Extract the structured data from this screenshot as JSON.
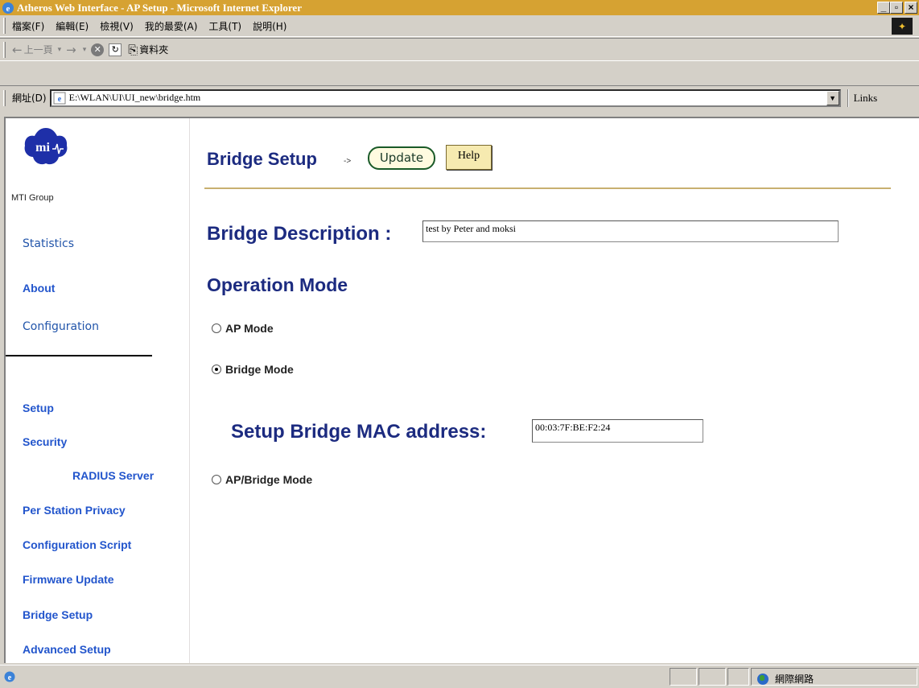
{
  "window": {
    "title": "Atheros Web Interface - AP Setup - Microsoft Internet Explorer",
    "controls": {
      "minimize": "_",
      "maximize": "▫",
      "close": "×"
    }
  },
  "menubar": {
    "items": [
      "檔案(F)",
      "編輯(E)",
      "檢視(V)",
      "我的最愛(A)",
      "工具(T)",
      "說明(H)"
    ]
  },
  "toolbar": {
    "back_label": "上一頁",
    "folders_label": "資料夾"
  },
  "addressbar": {
    "label": "網址(D)",
    "url": "E:\\WLAN\\UI\\UI_new\\bridge.htm",
    "links_label": "Links"
  },
  "sidebar": {
    "logo_caption": "MTI Group",
    "statistics": "Statistics",
    "about": "About",
    "configuration": "Configuration",
    "setup": "Setup",
    "security": "Security",
    "radius": "RADIUS Server",
    "per_station": "Per Station Privacy",
    "config_script": "Configuration Script",
    "firmware": "Firmware Update",
    "bridge_setup": "Bridge Setup",
    "advanced_setup": "Advanced Setup"
  },
  "main": {
    "heading": "Bridge Setup",
    "arrow": "->",
    "update_button": "Update",
    "help_button": "Help",
    "description_label": "Bridge Description :",
    "description_value": "test by Peter and moksi",
    "operation_mode_heading": "Operation Mode",
    "modes": [
      {
        "label": "AP Mode",
        "selected": false
      },
      {
        "label": "Bridge Mode",
        "selected": true
      },
      {
        "label": "AP/Bridge Mode",
        "selected": false
      }
    ],
    "mac_label": "Setup Bridge MAC address:",
    "mac_value": "00:03:7F:BE:F2:24"
  },
  "statusbar": {
    "zone_label": "網際網路"
  }
}
